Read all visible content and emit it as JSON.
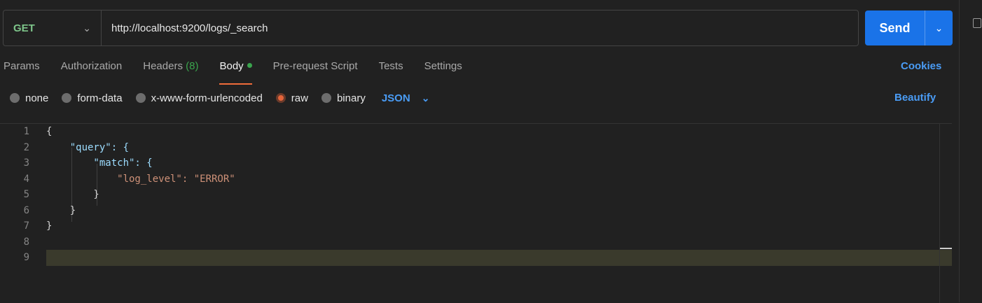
{
  "request": {
    "method": "GET",
    "url": "http://localhost:9200/logs/_search",
    "send_label": "Send"
  },
  "tabs": [
    {
      "label": "Params"
    },
    {
      "label": "Authorization"
    },
    {
      "label": "Headers",
      "count": "(8)"
    },
    {
      "label": "Body",
      "active": true
    },
    {
      "label": "Pre-request Script"
    },
    {
      "label": "Tests"
    },
    {
      "label": "Settings"
    }
  ],
  "cookies_label": "Cookies",
  "body_types": [
    {
      "label": "none"
    },
    {
      "label": "form-data"
    },
    {
      "label": "x-www-form-urlencoded"
    },
    {
      "label": "raw",
      "selected": true
    },
    {
      "label": "binary"
    }
  ],
  "language": "JSON",
  "beautify_label": "Beautify",
  "editor": {
    "line_numbers": [
      "1",
      "2",
      "3",
      "4",
      "5",
      "6",
      "7",
      "8",
      "9"
    ],
    "lines": [
      "{",
      "    \"query\": {",
      "        \"match\": {",
      "            \"log_level\": \"ERROR\"",
      "        }",
      "    }",
      "}",
      "",
      ""
    ]
  },
  "colors": {
    "accent": "#1a73e8",
    "method_get": "#7ec58a",
    "active_tab_underline": "#ef6c3a",
    "link": "#4a9cf5"
  }
}
